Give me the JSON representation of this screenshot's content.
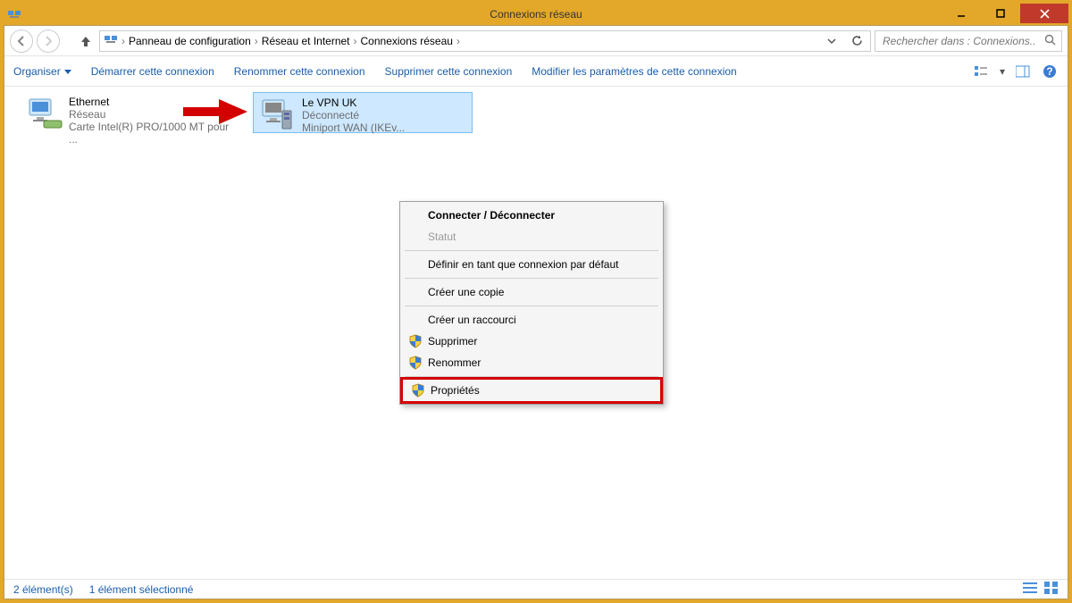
{
  "window": {
    "title": "Connexions réseau"
  },
  "breadcrumbs": {
    "b1": "Panneau de configuration",
    "b2": "Réseau et Internet",
    "b3": "Connexions réseau"
  },
  "search": {
    "placeholder": "Rechercher dans : Connexions..."
  },
  "commands": {
    "organize": "Organiser",
    "start": "Démarrer cette connexion",
    "rename": "Renommer cette connexion",
    "delete": "Supprimer cette connexion",
    "modify": "Modifier les paramètres de cette connexion"
  },
  "connections": {
    "ethernet": {
      "name": "Ethernet",
      "line2": "Réseau",
      "line3": "Carte Intel(R) PRO/1000 MT pour ..."
    },
    "vpn": {
      "name": "Le VPN UK",
      "line2": "Déconnecté",
      "line3": "Miniport WAN (IKEv..."
    }
  },
  "context_menu": {
    "connect": "Connecter / Déconnecter",
    "status": "Statut",
    "default": "Définir en tant que connexion par défaut",
    "copy": "Créer une copie",
    "shortcut": "Créer un raccourci",
    "delete": "Supprimer",
    "rename": "Renommer",
    "properties": "Propriétés"
  },
  "status": {
    "count": "2 élément(s)",
    "selected": "1 élément sélectionné"
  }
}
